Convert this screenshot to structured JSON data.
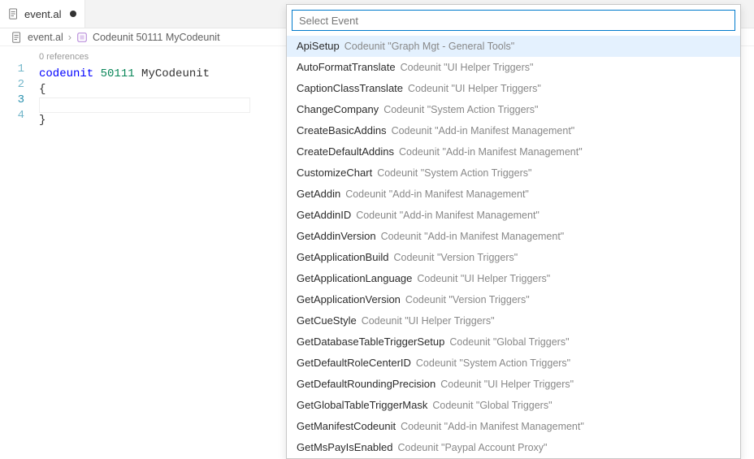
{
  "tab": {
    "filename": "event.al",
    "dirty": true
  },
  "breadcrumb": {
    "file": "event.al",
    "symbol": "Codeunit 50111 MyCodeunit"
  },
  "codelens": "0 references",
  "code": {
    "line1_kw": "codeunit",
    "line1_num": "50111",
    "line1_id": "MyCodeunit",
    "line2": "{",
    "line3": "",
    "line4": "}"
  },
  "line_numbers": [
    "1",
    "2",
    "3",
    "4"
  ],
  "quickpick": {
    "placeholder": "Select Event",
    "items": [
      {
        "name": "ApiSetup",
        "desc": "Codeunit \"Graph Mgt - General Tools\""
      },
      {
        "name": "AutoFormatTranslate",
        "desc": "Codeunit \"UI Helper Triggers\""
      },
      {
        "name": "CaptionClassTranslate",
        "desc": "Codeunit \"UI Helper Triggers\""
      },
      {
        "name": "ChangeCompany",
        "desc": "Codeunit \"System Action Triggers\""
      },
      {
        "name": "CreateBasicAddins",
        "desc": "Codeunit \"Add-in Manifest Management\""
      },
      {
        "name": "CreateDefaultAddins",
        "desc": "Codeunit \"Add-in Manifest Management\""
      },
      {
        "name": "CustomizeChart",
        "desc": "Codeunit \"System Action Triggers\""
      },
      {
        "name": "GetAddin",
        "desc": "Codeunit \"Add-in Manifest Management\""
      },
      {
        "name": "GetAddinID",
        "desc": "Codeunit \"Add-in Manifest Management\""
      },
      {
        "name": "GetAddinVersion",
        "desc": "Codeunit \"Add-in Manifest Management\""
      },
      {
        "name": "GetApplicationBuild",
        "desc": "Codeunit \"Version Triggers\""
      },
      {
        "name": "GetApplicationLanguage",
        "desc": "Codeunit \"UI Helper Triggers\""
      },
      {
        "name": "GetApplicationVersion",
        "desc": "Codeunit \"Version Triggers\""
      },
      {
        "name": "GetCueStyle",
        "desc": "Codeunit \"UI Helper Triggers\""
      },
      {
        "name": "GetDatabaseTableTriggerSetup",
        "desc": "Codeunit \"Global Triggers\""
      },
      {
        "name": "GetDefaultRoleCenterID",
        "desc": "Codeunit \"System Action Triggers\""
      },
      {
        "name": "GetDefaultRoundingPrecision",
        "desc": "Codeunit \"UI Helper Triggers\""
      },
      {
        "name": "GetGlobalTableTriggerMask",
        "desc": "Codeunit \"Global Triggers\""
      },
      {
        "name": "GetManifestCodeunit",
        "desc": "Codeunit \"Add-in Manifest Management\""
      },
      {
        "name": "GetMsPayIsEnabled",
        "desc": "Codeunit \"Paypal Account Proxy\""
      }
    ]
  }
}
